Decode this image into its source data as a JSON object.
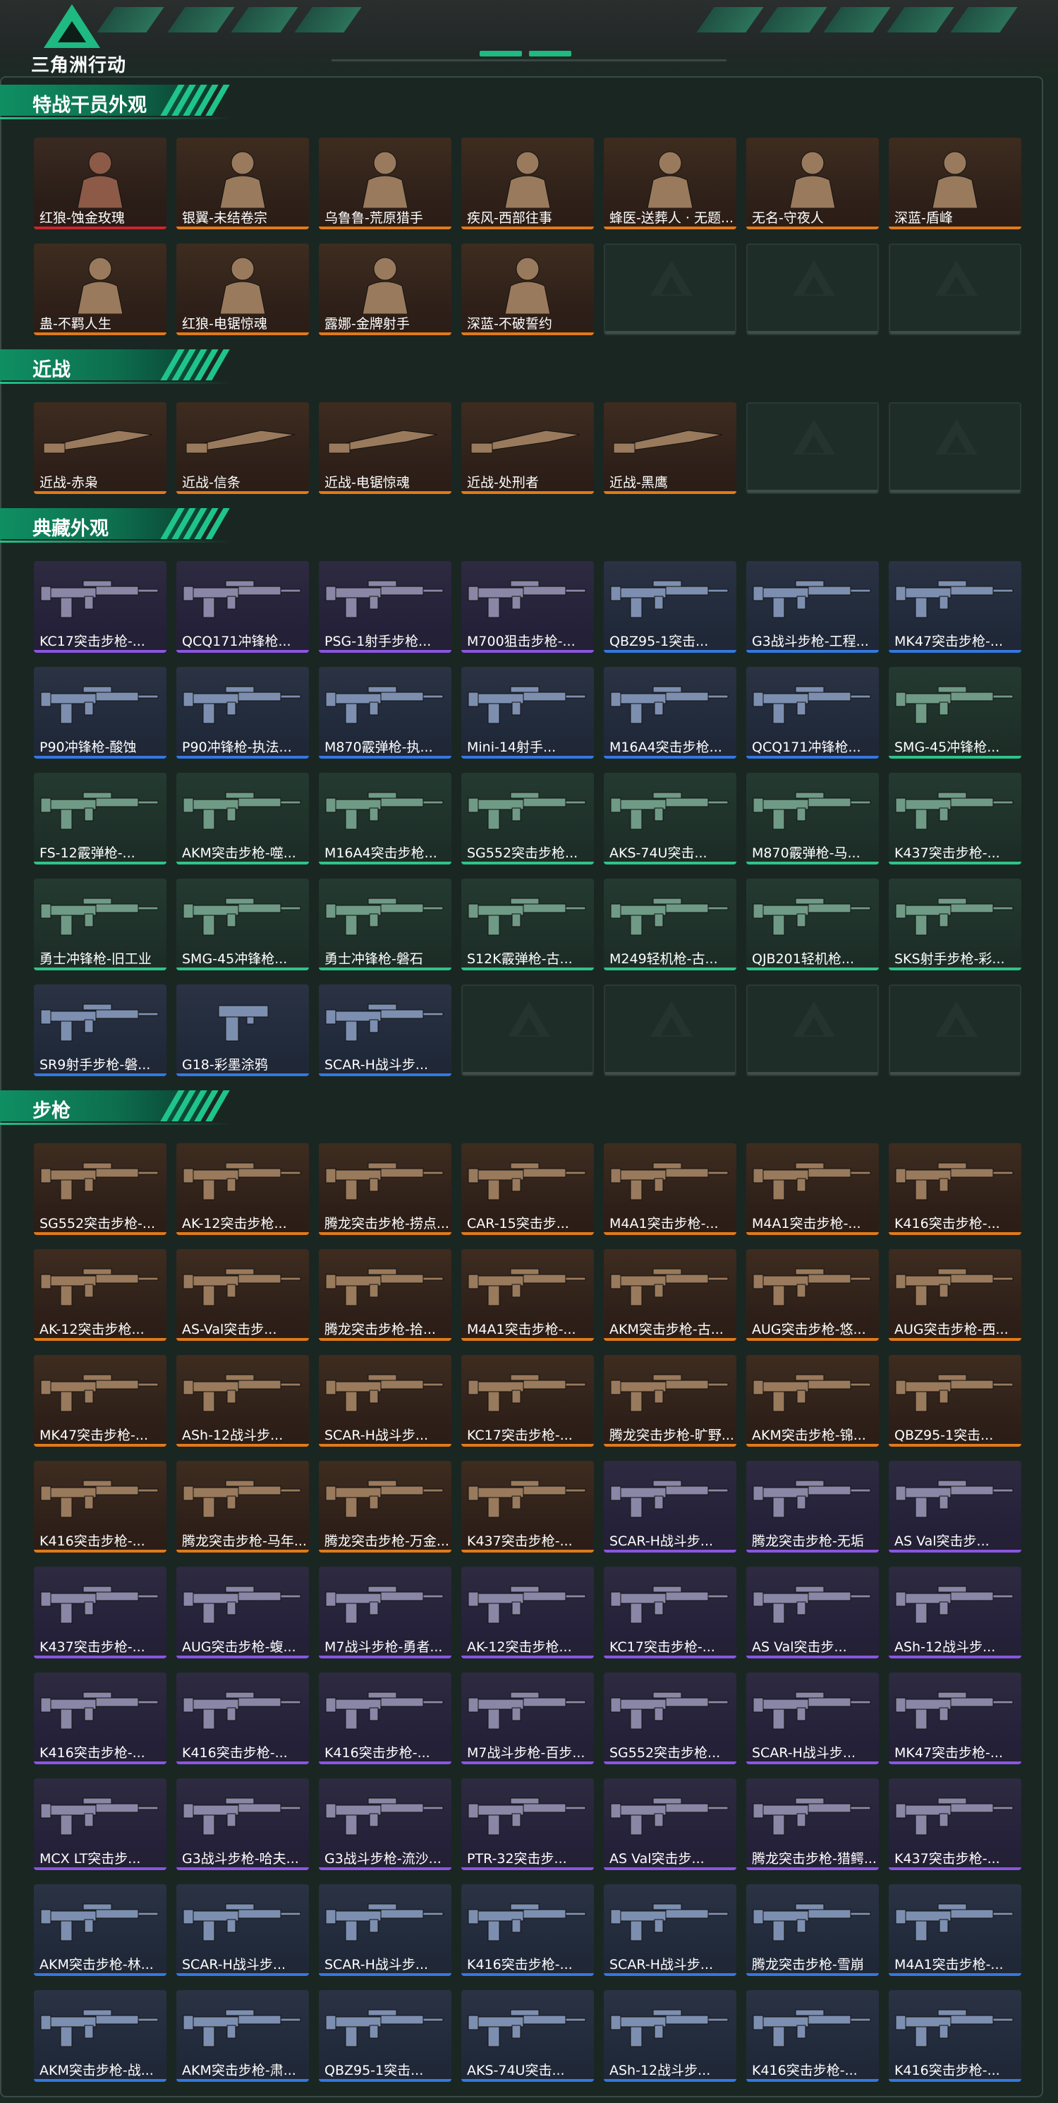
{
  "app": {
    "logo_text": "三角洲行动"
  },
  "colors": {
    "accent": "#1fc48b",
    "rarity": {
      "red": "#c9262e",
      "orange": "#e07a1a",
      "purple": "#8a55e3",
      "blue": "#3378e0",
      "green": "#2fc48a",
      "empty": "#3f4e49"
    }
  },
  "sections": [
    {
      "title": "特战干员外观",
      "items": [
        {
          "label": "红狼-蚀金玫瑰",
          "rarity": "red",
          "icon": "operator-portrait"
        },
        {
          "label": "银翼-未结卷宗",
          "rarity": "orange",
          "icon": "operator-portrait"
        },
        {
          "label": "乌鲁鲁-荒原猎手",
          "rarity": "orange",
          "icon": "operator-portrait"
        },
        {
          "label": "疾风-西部往事",
          "rarity": "orange",
          "icon": "operator-portrait"
        },
        {
          "label": "蜂医-送葬人 · 无题...",
          "rarity": "orange",
          "icon": "operator-portrait"
        },
        {
          "label": "无名-守夜人",
          "rarity": "orange",
          "icon": "operator-portrait"
        },
        {
          "label": "深蓝-盾峰",
          "rarity": "orange",
          "icon": "operator-portrait"
        },
        {
          "label": "蛊-不羁人生",
          "rarity": "orange",
          "icon": "operator-portrait"
        },
        {
          "label": "红狼-电锯惊魂",
          "rarity": "orange",
          "icon": "operator-portrait"
        },
        {
          "label": "露娜-金牌射手",
          "rarity": "orange",
          "icon": "operator-portrait"
        },
        {
          "label": "深蓝-不破誓约",
          "rarity": "orange",
          "icon": "operator-portrait"
        },
        {
          "label": "",
          "rarity": "empty"
        },
        {
          "label": "",
          "rarity": "empty"
        },
        {
          "label": "",
          "rarity": "empty"
        }
      ]
    },
    {
      "title": "近战",
      "items": [
        {
          "label": "近战-赤枭",
          "rarity": "orange",
          "icon": "melee-weapon"
        },
        {
          "label": "近战-信条",
          "rarity": "orange",
          "icon": "melee-weapon"
        },
        {
          "label": "近战-电锯惊魂",
          "rarity": "orange",
          "icon": "melee-weapon"
        },
        {
          "label": "近战-处刑者",
          "rarity": "orange",
          "icon": "melee-weapon"
        },
        {
          "label": "近战-黑鹰",
          "rarity": "orange",
          "icon": "melee-weapon"
        },
        {
          "label": "",
          "rarity": "empty"
        },
        {
          "label": "",
          "rarity": "empty"
        }
      ]
    },
    {
      "title": "典藏外观",
      "items": [
        {
          "label": "KC17突击步枪-...",
          "rarity": "purple",
          "icon": "rifle"
        },
        {
          "label": "QCQ171冲锋枪...",
          "rarity": "purple",
          "icon": "rifle"
        },
        {
          "label": "PSG-1射手步枪...",
          "rarity": "purple",
          "icon": "rifle"
        },
        {
          "label": "M700狙击步枪-...",
          "rarity": "purple",
          "icon": "rifle"
        },
        {
          "label": "QBZ95-1突击...",
          "rarity": "blue",
          "icon": "rifle"
        },
        {
          "label": "G3战斗步枪-工程...",
          "rarity": "blue",
          "icon": "rifle"
        },
        {
          "label": "MK47突击步枪-...",
          "rarity": "blue",
          "icon": "rifle"
        },
        {
          "label": "P90冲锋枪-酸蚀",
          "rarity": "blue",
          "icon": "rifle"
        },
        {
          "label": "P90冲锋枪-执法...",
          "rarity": "blue",
          "icon": "rifle"
        },
        {
          "label": "M870霰弹枪-执...",
          "rarity": "blue",
          "icon": "rifle"
        },
        {
          "label": "Mini-14射手...",
          "rarity": "blue",
          "icon": "rifle"
        },
        {
          "label": "M16A4突击步枪...",
          "rarity": "blue",
          "icon": "rifle"
        },
        {
          "label": "QCQ171冲锋枪...",
          "rarity": "blue",
          "icon": "rifle"
        },
        {
          "label": "SMG-45冲锋枪...",
          "rarity": "green",
          "icon": "rifle"
        },
        {
          "label": "FS-12霰弹枪-...",
          "rarity": "green",
          "icon": "rifle"
        },
        {
          "label": "AKM突击步枪-噬...",
          "rarity": "green",
          "icon": "rifle"
        },
        {
          "label": "M16A4突击步枪...",
          "rarity": "green",
          "icon": "rifle"
        },
        {
          "label": "SG552突击步枪...",
          "rarity": "green",
          "icon": "rifle"
        },
        {
          "label": "AKS-74U突击...",
          "rarity": "green",
          "icon": "rifle"
        },
        {
          "label": "M870霰弹枪-马...",
          "rarity": "green",
          "icon": "rifle"
        },
        {
          "label": "K437突击步枪-...",
          "rarity": "green",
          "icon": "rifle"
        },
        {
          "label": "勇士冲锋枪-旧工业",
          "rarity": "green",
          "icon": "rifle"
        },
        {
          "label": "SMG-45冲锋枪...",
          "rarity": "green",
          "icon": "rifle"
        },
        {
          "label": "勇士冲锋枪-磐石",
          "rarity": "green",
          "icon": "rifle"
        },
        {
          "label": "S12K霰弹枪-古...",
          "rarity": "green",
          "icon": "rifle"
        },
        {
          "label": "M249轻机枪-古...",
          "rarity": "green",
          "icon": "rifle"
        },
        {
          "label": "QJB201轻机枪...",
          "rarity": "green",
          "icon": "rifle"
        },
        {
          "label": "SKS射手步枪-彩...",
          "rarity": "green",
          "icon": "rifle"
        },
        {
          "label": "SR9射手步枪-磐...",
          "rarity": "blue",
          "icon": "rifle"
        },
        {
          "label": "G18-彩墨涂鸦",
          "rarity": "blue",
          "icon": "pistol"
        },
        {
          "label": "SCAR-H战斗步...",
          "rarity": "blue",
          "icon": "rifle"
        },
        {
          "label": "",
          "rarity": "empty"
        },
        {
          "label": "",
          "rarity": "empty"
        },
        {
          "label": "",
          "rarity": "empty"
        },
        {
          "label": "",
          "rarity": "empty"
        }
      ]
    },
    {
      "title": "步枪",
      "items": [
        {
          "label": "SG552突击步枪-...",
          "rarity": "orange",
          "icon": "rifle"
        },
        {
          "label": "AK-12突击步枪...",
          "rarity": "orange",
          "icon": "rifle"
        },
        {
          "label": "腾龙突击步枪-捞点...",
          "rarity": "orange",
          "icon": "rifle"
        },
        {
          "label": "CAR-15突击步...",
          "rarity": "orange",
          "icon": "rifle"
        },
        {
          "label": "M4A1突击步枪-...",
          "rarity": "orange",
          "icon": "rifle"
        },
        {
          "label": "M4A1突击步枪-...",
          "rarity": "orange",
          "icon": "rifle"
        },
        {
          "label": "K416突击步枪-...",
          "rarity": "orange",
          "icon": "rifle"
        },
        {
          "label": "AK-12突击步枪...",
          "rarity": "orange",
          "icon": "rifle"
        },
        {
          "label": "AS-Val突击步...",
          "rarity": "orange",
          "icon": "rifle"
        },
        {
          "label": "腾龙突击步枪-拾...",
          "rarity": "orange",
          "icon": "rifle"
        },
        {
          "label": "M4A1突击步枪-...",
          "rarity": "orange",
          "icon": "rifle"
        },
        {
          "label": "AKM突击步枪-古...",
          "rarity": "orange",
          "icon": "rifle"
        },
        {
          "label": "AUG突击步枪-悠...",
          "rarity": "orange",
          "icon": "rifle"
        },
        {
          "label": "AUG突击步枪-西...",
          "rarity": "orange",
          "icon": "rifle"
        },
        {
          "label": "MK47突击步枪-...",
          "rarity": "orange",
          "icon": "rifle"
        },
        {
          "label": "ASh-12战斗步...",
          "rarity": "orange",
          "icon": "rifle"
        },
        {
          "label": "SCAR-H战斗步...",
          "rarity": "orange",
          "icon": "rifle"
        },
        {
          "label": "KC17突击步枪-...",
          "rarity": "orange",
          "icon": "rifle"
        },
        {
          "label": "腾龙突击步枪-旷野...",
          "rarity": "orange",
          "icon": "rifle"
        },
        {
          "label": "AKM突击步枪-锦...",
          "rarity": "orange",
          "icon": "rifle"
        },
        {
          "label": "QBZ95-1突击...",
          "rarity": "orange",
          "icon": "rifle"
        },
        {
          "label": "K416突击步枪-...",
          "rarity": "orange",
          "icon": "rifle"
        },
        {
          "label": "腾龙突击步枪-马年...",
          "rarity": "orange",
          "icon": "rifle"
        },
        {
          "label": "腾龙突击步枪-万金...",
          "rarity": "orange",
          "icon": "rifle"
        },
        {
          "label": "K437突击步枪-...",
          "rarity": "orange",
          "icon": "rifle"
        },
        {
          "label": "SCAR-H战斗步...",
          "rarity": "purple",
          "icon": "rifle"
        },
        {
          "label": "腾龙突击步枪-无垢",
          "rarity": "purple",
          "icon": "rifle"
        },
        {
          "label": "AS Val突击步...",
          "rarity": "purple",
          "icon": "rifle"
        },
        {
          "label": "K437突击步枪-...",
          "rarity": "purple",
          "icon": "rifle"
        },
        {
          "label": "AUG突击步枪-蝮...",
          "rarity": "purple",
          "icon": "rifle"
        },
        {
          "label": "M7战斗步枪-勇者...",
          "rarity": "purple",
          "icon": "rifle"
        },
        {
          "label": "AK-12突击步枪...",
          "rarity": "purple",
          "icon": "rifle"
        },
        {
          "label": "KC17突击步枪-...",
          "rarity": "purple",
          "icon": "rifle"
        },
        {
          "label": "AS Val突击步...",
          "rarity": "purple",
          "icon": "rifle"
        },
        {
          "label": "ASh-12战斗步...",
          "rarity": "purple",
          "icon": "rifle"
        },
        {
          "label": "K416突击步枪-...",
          "rarity": "purple",
          "icon": "rifle"
        },
        {
          "label": "K416突击步枪-...",
          "rarity": "purple",
          "icon": "rifle"
        },
        {
          "label": "K416突击步枪-...",
          "rarity": "purple",
          "icon": "rifle"
        },
        {
          "label": "M7战斗步枪-百步...",
          "rarity": "purple",
          "icon": "rifle"
        },
        {
          "label": "SG552突击步枪...",
          "rarity": "purple",
          "icon": "rifle"
        },
        {
          "label": "SCAR-H战斗步...",
          "rarity": "purple",
          "icon": "rifle"
        },
        {
          "label": "MK47突击步枪-...",
          "rarity": "purple",
          "icon": "rifle"
        },
        {
          "label": "MCX LT突击步...",
          "rarity": "purple",
          "icon": "rifle"
        },
        {
          "label": "G3战斗步枪-哈夫...",
          "rarity": "purple",
          "icon": "rifle"
        },
        {
          "label": "G3战斗步枪-流沙...",
          "rarity": "purple",
          "icon": "rifle"
        },
        {
          "label": "PTR-32突击步...",
          "rarity": "purple",
          "icon": "rifle"
        },
        {
          "label": "AS Val突击步...",
          "rarity": "purple",
          "icon": "rifle"
        },
        {
          "label": "腾龙突击步枪-猎鳄...",
          "rarity": "purple",
          "icon": "rifle"
        },
        {
          "label": "K437突击步枪-...",
          "rarity": "purple",
          "icon": "rifle"
        },
        {
          "label": "AKM突击步枪-林...",
          "rarity": "blue",
          "icon": "rifle"
        },
        {
          "label": "SCAR-H战斗步...",
          "rarity": "blue",
          "icon": "rifle"
        },
        {
          "label": "SCAR-H战斗步...",
          "rarity": "blue",
          "icon": "rifle"
        },
        {
          "label": "K416突击步枪-...",
          "rarity": "blue",
          "icon": "rifle"
        },
        {
          "label": "SCAR-H战斗步...",
          "rarity": "blue",
          "icon": "rifle"
        },
        {
          "label": "腾龙突击步枪-雪崩",
          "rarity": "blue",
          "icon": "rifle"
        },
        {
          "label": "M4A1突击步枪-...",
          "rarity": "blue",
          "icon": "rifle"
        },
        {
          "label": "AKM突击步枪-战...",
          "rarity": "blue",
          "icon": "rifle"
        },
        {
          "label": "AKM突击步枪-肃...",
          "rarity": "blue",
          "icon": "rifle"
        },
        {
          "label": "QBZ95-1突击...",
          "rarity": "blue",
          "icon": "rifle"
        },
        {
          "label": "AKS-74U突击...",
          "rarity": "blue",
          "icon": "rifle"
        },
        {
          "label": "ASh-12战斗步...",
          "rarity": "blue",
          "icon": "rifle"
        },
        {
          "label": "K416突击步枪-...",
          "rarity": "blue",
          "icon": "rifle"
        },
        {
          "label": "K416突击步枪-...",
          "rarity": "blue",
          "icon": "rifle"
        }
      ]
    }
  ]
}
